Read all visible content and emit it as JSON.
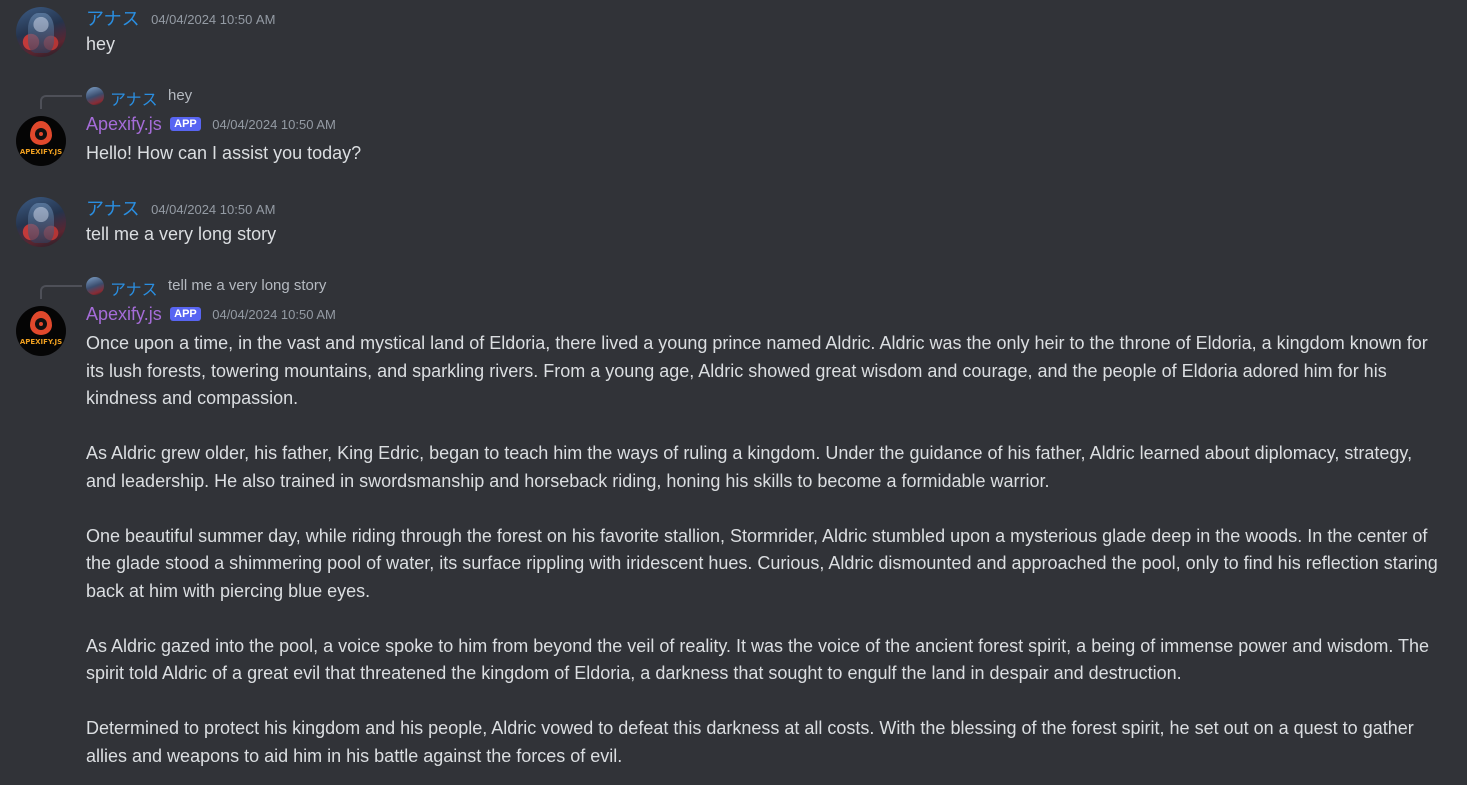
{
  "messages": [
    {
      "author": "アナス",
      "timestamp": "04/04/2024 10:50 AM",
      "paragraphs": [
        "hey"
      ]
    },
    {
      "reply_to": {
        "author": "アナス",
        "text": "hey"
      },
      "author": "Apexify.js",
      "tag": "APP",
      "avatar_text": "APEXIFY.JS",
      "timestamp": "04/04/2024 10:50 AM",
      "paragraphs": [
        "Hello! How can I assist you today?"
      ]
    },
    {
      "author": "アナス",
      "timestamp": "04/04/2024 10:50 AM",
      "paragraphs": [
        "tell me a very long story"
      ]
    },
    {
      "reply_to": {
        "author": "アナス",
        "text": "tell me a very long story"
      },
      "author": "Apexify.js",
      "tag": "APP",
      "avatar_text": "APEXIFY.JS",
      "timestamp": "04/04/2024 10:50 AM",
      "paragraphs": [
        "Once upon a time, in the vast and mystical land of Eldoria, there lived a young prince named Aldric. Aldric was the only heir to the throne of Eldoria, a kingdom known for its lush forests, towering mountains, and sparkling rivers. From a young age, Aldric showed great wisdom and courage, and the people of Eldoria adored him for his kindness and compassion.",
        "As Aldric grew older, his father, King Edric, began to teach him the ways of ruling a kingdom. Under the guidance of his father, Aldric learned about diplomacy, strategy, and leadership. He also trained in swordsmanship and horseback riding, honing his skills to become a formidable warrior.",
        "One beautiful summer day, while riding through the forest on his favorite stallion, Stormrider, Aldric stumbled upon a mysterious glade deep in the woods. In the center of the glade stood a shimmering pool of water, its surface rippling with iridescent hues. Curious, Aldric dismounted and approached the pool, only to find his reflection staring back at him with piercing blue eyes.",
        "As Aldric gazed into the pool, a voice spoke to him from beyond the veil of reality. It was the voice of the ancient forest spirit, a being of immense power and wisdom. The spirit told Aldric of a great evil that threatened the kingdom of Eldoria, a darkness that sought to engulf the land in despair and destruction.",
        "Determined to protect his kingdom and his people, Aldric vowed to defeat this darkness at all costs. With the blessing of the forest spirit, he set out on a quest to gather allies and weapons to aid him in his battle against the forces of evil."
      ]
    }
  ]
}
